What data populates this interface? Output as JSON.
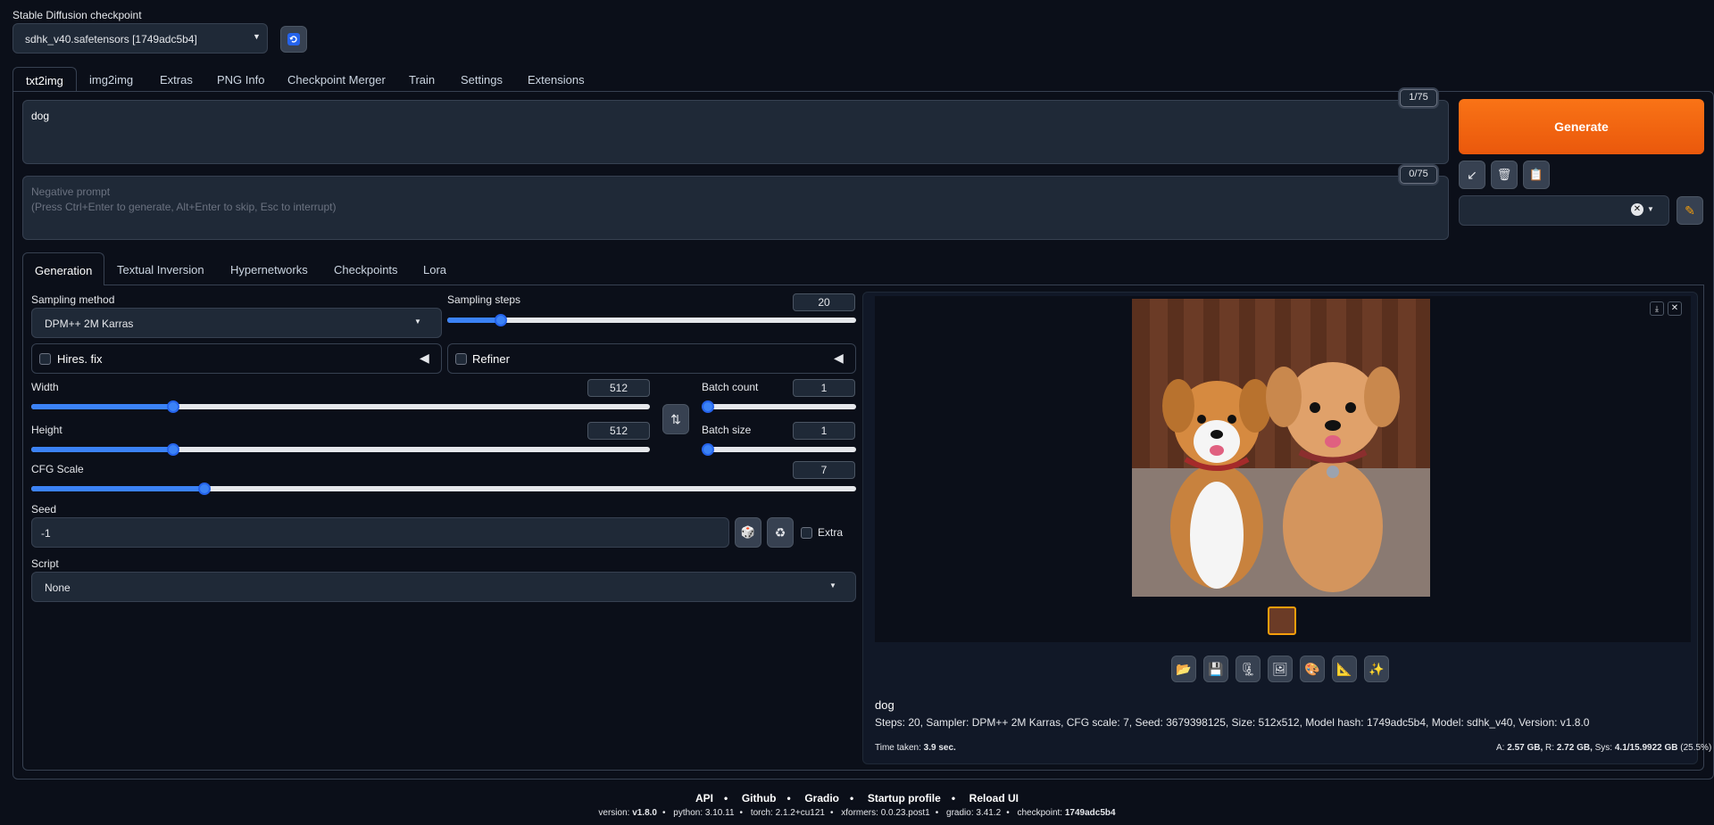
{
  "checkpoint": {
    "label": "Stable Diffusion checkpoint",
    "value": "sdhk_v40.safetensors [1749adc5b4]"
  },
  "main_tabs": [
    "txt2img",
    "img2img",
    "Extras",
    "PNG Info",
    "Checkpoint Merger",
    "Train",
    "Settings",
    "Extensions"
  ],
  "prompt": {
    "value": "dog",
    "counter": "1/75"
  },
  "negative_prompt": {
    "placeholder_line1": "Negative prompt",
    "placeholder_line2": "(Press Ctrl+Enter to generate, Alt+Enter to skip, Esc to interrupt)",
    "counter": "0/75"
  },
  "generate_label": "Generate",
  "sub_tabs": [
    "Generation",
    "Textual Inversion",
    "Hypernetworks",
    "Checkpoints",
    "Lora"
  ],
  "sampling": {
    "method_label": "Sampling method",
    "method_value": "DPM++ 2M Karras",
    "steps_label": "Sampling steps",
    "steps_value": "20",
    "steps_fraction": 0.13
  },
  "hires": {
    "label": "Hires. fix"
  },
  "refiner": {
    "label": "Refiner"
  },
  "width": {
    "label": "Width",
    "value": "512",
    "fraction": 0.23
  },
  "height": {
    "label": "Height",
    "value": "512",
    "fraction": 0.23
  },
  "batch_count": {
    "label": "Batch count",
    "value": "1"
  },
  "batch_size": {
    "label": "Batch size",
    "value": "1"
  },
  "cfg": {
    "label": "CFG Scale",
    "value": "7",
    "fraction": 0.21
  },
  "seed": {
    "label": "Seed",
    "value": "-1",
    "extra_label": "Extra"
  },
  "script": {
    "label": "Script",
    "value": "None"
  },
  "output": {
    "prompt": "dog",
    "params": "Steps: 20, Sampler: DPM++ 2M Karras, CFG scale: 7, Seed: 3679398125, Size: 512x512, Model hash: 1749adc5b4, Model: sdhk_v40, Version: v1.8.0",
    "time_label": "Time taken:",
    "time_value": "3.9 sec.",
    "vram_a_label": "A:",
    "vram_a": "2.57 GB,",
    "vram_r_label": "R:",
    "vram_r": "2.72 GB,",
    "vram_sys_label": "Sys:",
    "vram_sys": "4.1/15.9922 GB",
    "vram_pct": "(25.5%)"
  },
  "footer": {
    "links": [
      "API",
      "Github",
      "Gradio",
      "Startup profile",
      "Reload UI"
    ],
    "versions": [
      {
        "k": "version:",
        "v": "v1.8.0"
      },
      {
        "k": "python:",
        "v": "3.10.11"
      },
      {
        "k": "torch:",
        "v": "2.1.2+cu121"
      },
      {
        "k": "xformers:",
        "v": "0.0.23.post1"
      },
      {
        "k": "gradio:",
        "v": "3.41.2"
      },
      {
        "k": "checkpoint:",
        "v": "1749adc5b4"
      }
    ]
  },
  "colors": {
    "accent": "#3b82f6",
    "generate": "#ea580c",
    "background": "#0b0f19",
    "panel": "#1f2937"
  }
}
